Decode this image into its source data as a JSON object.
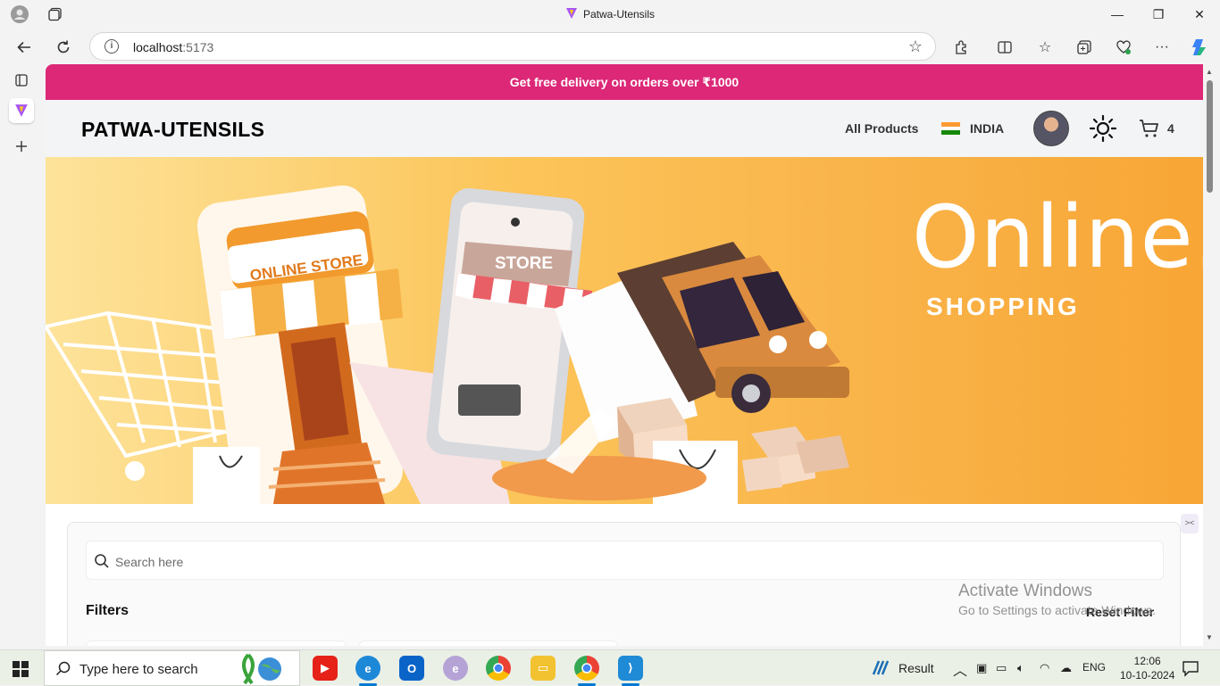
{
  "browser": {
    "tab_title": "Patwa-Utensils",
    "url_host": "localhost",
    "url_port": ":5173"
  },
  "promo_bar": {
    "text": "Get free delivery on orders over ₹1000",
    "color": "#dc2877"
  },
  "header": {
    "brand": "PATWA-UTENSILS",
    "nav_all_products": "All Products",
    "country": "INDIA",
    "cart_count": "4"
  },
  "hero": {
    "headline": "Online.",
    "subheadline": "SHOPPING",
    "illustration_labels": [
      "ONLINE STORE",
      "STORE"
    ]
  },
  "filters_panel": {
    "search_placeholder": "Search here",
    "filters_title": "Filters",
    "reset_label": "Reset Filter"
  },
  "watermark": {
    "line1": "Activate Windows",
    "line2": "Go to Settings to activate Windows."
  },
  "taskbar": {
    "search_placeholder": "Type here to search",
    "tray_label": "Result",
    "language": "ENG",
    "time": "12:06",
    "date": "10-10-2024"
  }
}
